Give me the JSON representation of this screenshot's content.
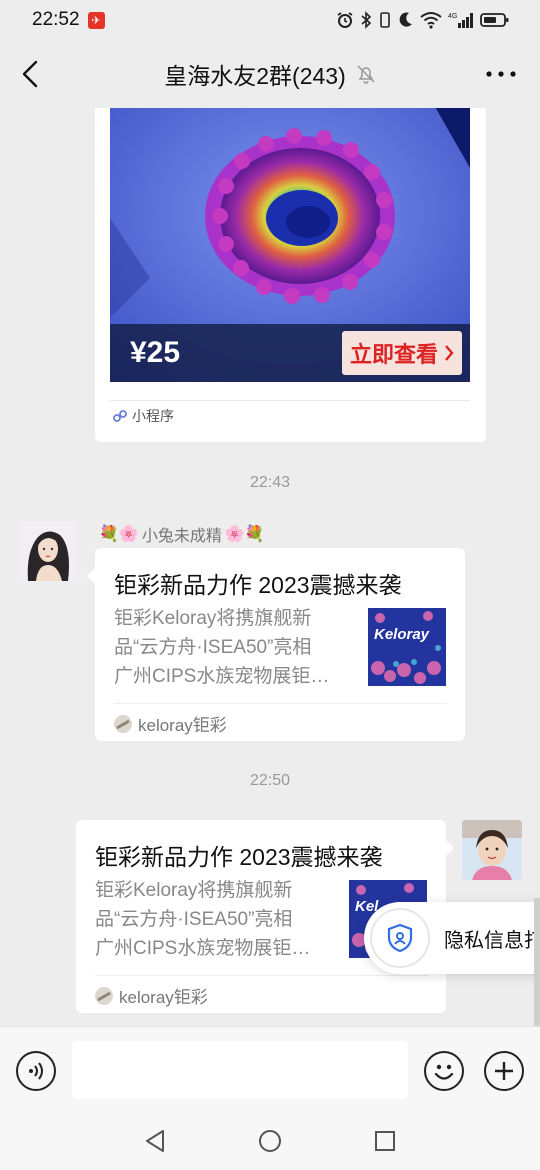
{
  "status_bar": {
    "time": "22:52",
    "network": "4G"
  },
  "header": {
    "title": "皇海水友2群(243)"
  },
  "chat": {
    "mini_program": {
      "price": "¥25",
      "button": "立即查看",
      "label": "小程序"
    },
    "timestamps": [
      "22:43",
      "22:50"
    ],
    "sender_name": "小兔未成精",
    "link_cards": [
      {
        "title": "钜彩新品力作 2023震撼来袭",
        "desc_lines": [
          "钜彩Keloray将携旗舰新",
          "品“云方舟·ISEA50”亮相",
          "广州CIPS水族宠物展钜…"
        ],
        "thumb_text": "Keloray",
        "source": "keloray钜彩"
      },
      {
        "title": "钜彩新品力作 2023震撼来袭",
        "desc_lines": [
          "钜彩Keloray将携旗舰新",
          "品“云方舟·ISEA50”亮相",
          "广州CIPS水族宠物展钜…"
        ],
        "thumb_text": "Kel",
        "source": "keloray钜彩"
      }
    ],
    "privacy_popup": "隐私信息打"
  },
  "input": {
    "value": "",
    "placeholder": ""
  },
  "colors": {
    "background": "#ededed",
    "bubble": "#ffffff",
    "timestamp": "#999999",
    "price_button_text": "#dd2222"
  }
}
